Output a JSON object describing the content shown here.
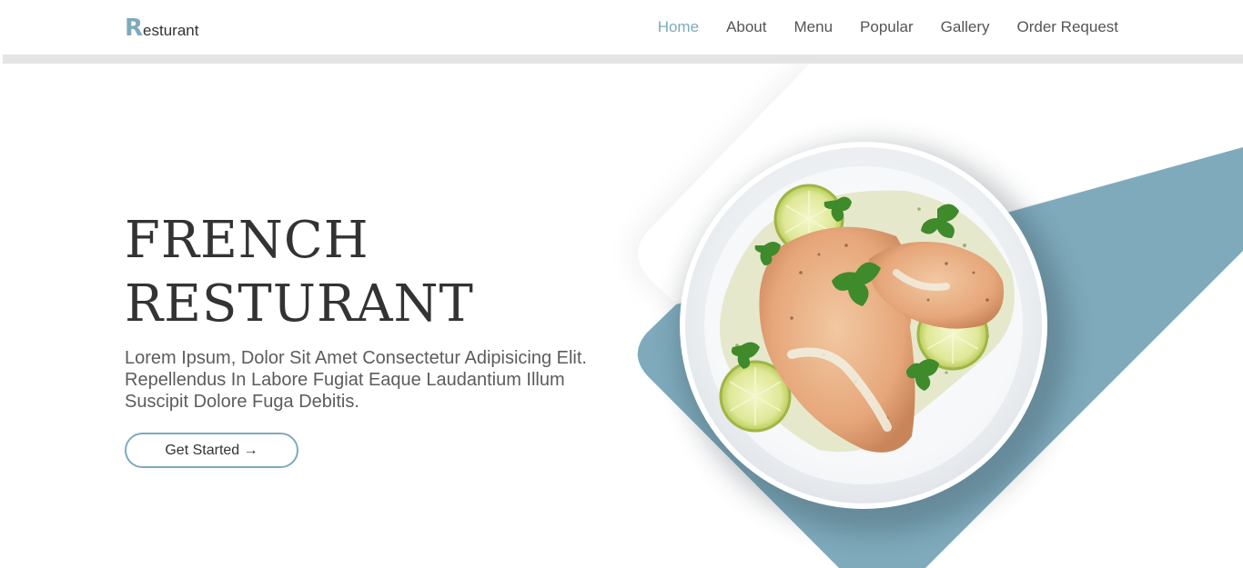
{
  "brand": {
    "initial": "R",
    "rest": "esturant",
    "accent_color": "#7eaabc"
  },
  "nav": {
    "items": [
      {
        "label": "Home",
        "active": true
      },
      {
        "label": "About",
        "active": false
      },
      {
        "label": "Menu",
        "active": false
      },
      {
        "label": "Popular",
        "active": false
      },
      {
        "label": "Gallery",
        "active": false
      },
      {
        "label": "Order Request",
        "active": false
      }
    ]
  },
  "hero": {
    "title_line1": "FRENCH",
    "title_line2": "RESTURANT",
    "description": "Lorem Ipsum, Dolor Sit Amet Consectetur Adipisicing Elit. Repellendus In Labore Fugiat Eaque Laudantium Illum Suscipit Dolore Fuga Debitis.",
    "cta_label": "Get Started →"
  },
  "colors": {
    "accent": "#7eaabc",
    "text_dark": "#333333",
    "text_muted": "#5c5c5c"
  }
}
